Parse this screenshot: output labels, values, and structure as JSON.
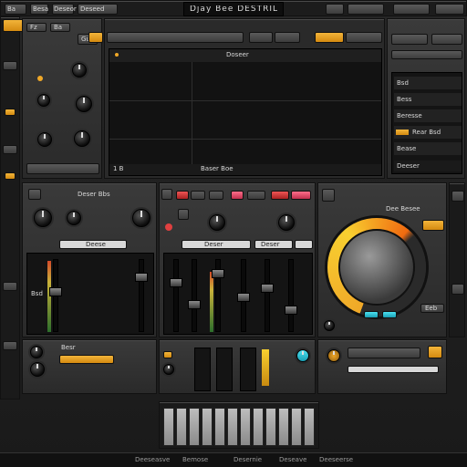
{
  "window": {
    "title": "Djay Bee DESTRIL",
    "menu": [
      "Ba",
      "Besa",
      "Deseor sese",
      "Deseed"
    ]
  },
  "top_left": {
    "labels": [
      "Fz",
      "Ba",
      "Gu"
    ]
  },
  "screen": {
    "header": "Doseer",
    "footer_left": "1 B",
    "footer_right": "Baser Boe"
  },
  "right_panel": {
    "rows": [
      "Bsd",
      "Bess",
      "Beresse",
      "Rear Bsd",
      "Bease"
    ],
    "footer": "Deeser"
  },
  "deck_left": {
    "title": "Deser Bbs",
    "strip_label": "Deese",
    "channel_label": "Bsd"
  },
  "center_mixer": {
    "strip_labels": [
      "Deser",
      "Deser",
      "Deser"
    ]
  },
  "jog": {
    "header": "Dee Besee",
    "tag": "Eeb"
  },
  "bottom_left": {
    "label": "Besr"
  },
  "status_bar": {
    "items": [
      "Deeseasve",
      "Bemose",
      "Desernie",
      "Deseave",
      "Deeseerse"
    ]
  },
  "colors": {
    "accent": "#f0a828",
    "led_red": "#e04040",
    "cyan": "#3cd4e8",
    "background": "#1e1e1e"
  },
  "icons": [
    "knob-icon",
    "play-icon",
    "meter-icon",
    "jog-wheel-icon"
  ]
}
